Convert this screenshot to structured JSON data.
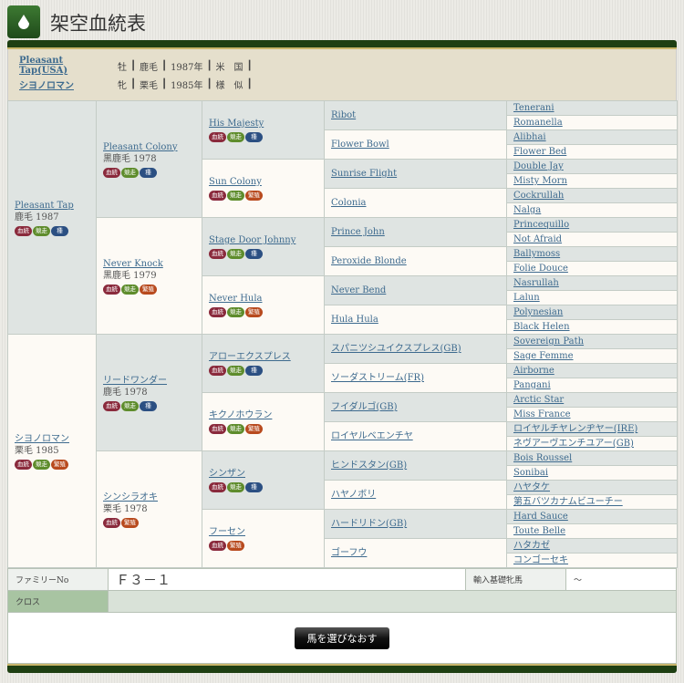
{
  "header": {
    "title": "架空血統表",
    "icon": "drop-icon"
  },
  "info": [
    {
      "name": "Pleasant Tap(USA)",
      "sex": "牡",
      "color": "鹿毛",
      "year": "1987年",
      "origin": "米　国"
    },
    {
      "name": "シヨノロマン",
      "sex": "牝",
      "color": "栗毛",
      "year": "1985年",
      "origin": "様　似"
    }
  ],
  "badge_labels": {
    "blood": "血統",
    "race": "競走",
    "stud": "種",
    "broodmare": "繁殖"
  },
  "colors": {
    "blood": "#8a2a3c",
    "race": "#5e8c2c",
    "stud": "#2b4f82",
    "broodmare": "#b84a1e"
  },
  "gen1": [
    {
      "name": "Pleasant Tap",
      "meta": "鹿毛 1987",
      "badges": [
        "blood",
        "race",
        "stud"
      ]
    },
    {
      "name": "シヨノロマン",
      "meta": "栗毛 1985",
      "badges": [
        "blood",
        "race",
        "broodmare"
      ]
    }
  ],
  "gen2": [
    {
      "name": "Pleasant Colony",
      "meta": "黒鹿毛 1978",
      "badges": [
        "blood",
        "race",
        "stud"
      ]
    },
    {
      "name": "Never Knock",
      "meta": "黒鹿毛 1979",
      "badges": [
        "blood",
        "race",
        "broodmare"
      ]
    },
    {
      "name": "リードワンダー",
      "meta": "鹿毛 1978",
      "badges": [
        "blood",
        "race",
        "stud"
      ]
    },
    {
      "name": "シンシラオキ",
      "meta": "栗毛 1978",
      "badges": [
        "blood",
        "broodmare"
      ]
    }
  ],
  "gen3": [
    {
      "name": "His Majesty",
      "badges": [
        "blood",
        "race",
        "stud"
      ]
    },
    {
      "name": "Sun Colony",
      "badges": [
        "blood",
        "race",
        "broodmare"
      ]
    },
    {
      "name": "Stage Door Johnny",
      "badges": [
        "blood",
        "race",
        "stud"
      ]
    },
    {
      "name": "Never Hula",
      "badges": [
        "blood",
        "race",
        "broodmare"
      ]
    },
    {
      "name": "アローエクスプレス",
      "badges": [
        "blood",
        "race",
        "stud"
      ]
    },
    {
      "name": "キクノホウラン",
      "badges": [
        "blood",
        "race",
        "broodmare"
      ]
    },
    {
      "name": "シンザン",
      "badges": [
        "blood",
        "race",
        "stud"
      ]
    },
    {
      "name": "フーセン",
      "badges": [
        "blood",
        "broodmare"
      ]
    }
  ],
  "gen4": [
    "Ribot",
    "Flower Bowl",
    "Sunrise Flight",
    "Colonia",
    "Prince John",
    "Peroxide Blonde",
    "Never Bend",
    "Hula Hula",
    "スパニツシユイクスプレス(GB)",
    "ソーダストリーム(FR)",
    "フイダルゴ(GB)",
    "ロイヤルベエンチヤ",
    "ヒンドスタン(GB)",
    "ハヤノボリ",
    "ハードリドン(GB)",
    "ゴーフウ"
  ],
  "gen5": [
    "Tenerani",
    "Romanella",
    "Alibhai",
    "Flower Bed",
    "Double Jay",
    "Misty Morn",
    "Cockrullah",
    "Nalga",
    "Princequillo",
    "Not Afraid",
    "Ballymoss",
    "Folie Douce",
    "Nasrullah",
    "Lalun",
    "Polynesian",
    "Black Helen",
    "Sovereign Path",
    "Sage Femme",
    "Airborne",
    "Pangani",
    "Arctic Star",
    "Miss France",
    "ロイヤルチヤレンヂヤー(IRE)",
    "ネヴアーヴエンチユアー(GB)",
    "Bois Roussel",
    "Sonibai",
    "ハヤタケ",
    "第五バツカナムビユーチー",
    "Hard Sauce",
    "Toute Belle",
    "ハタカゼ",
    "コンゴーセキ"
  ],
  "footer": {
    "family_label": "ファミリーNo",
    "family_value": "Ｆ３－１",
    "import_label": "輸入基礎牝馬",
    "import_value": "～",
    "cross_label": "クロス",
    "cross_value": "",
    "reselect_button": "馬を選びなおす"
  }
}
